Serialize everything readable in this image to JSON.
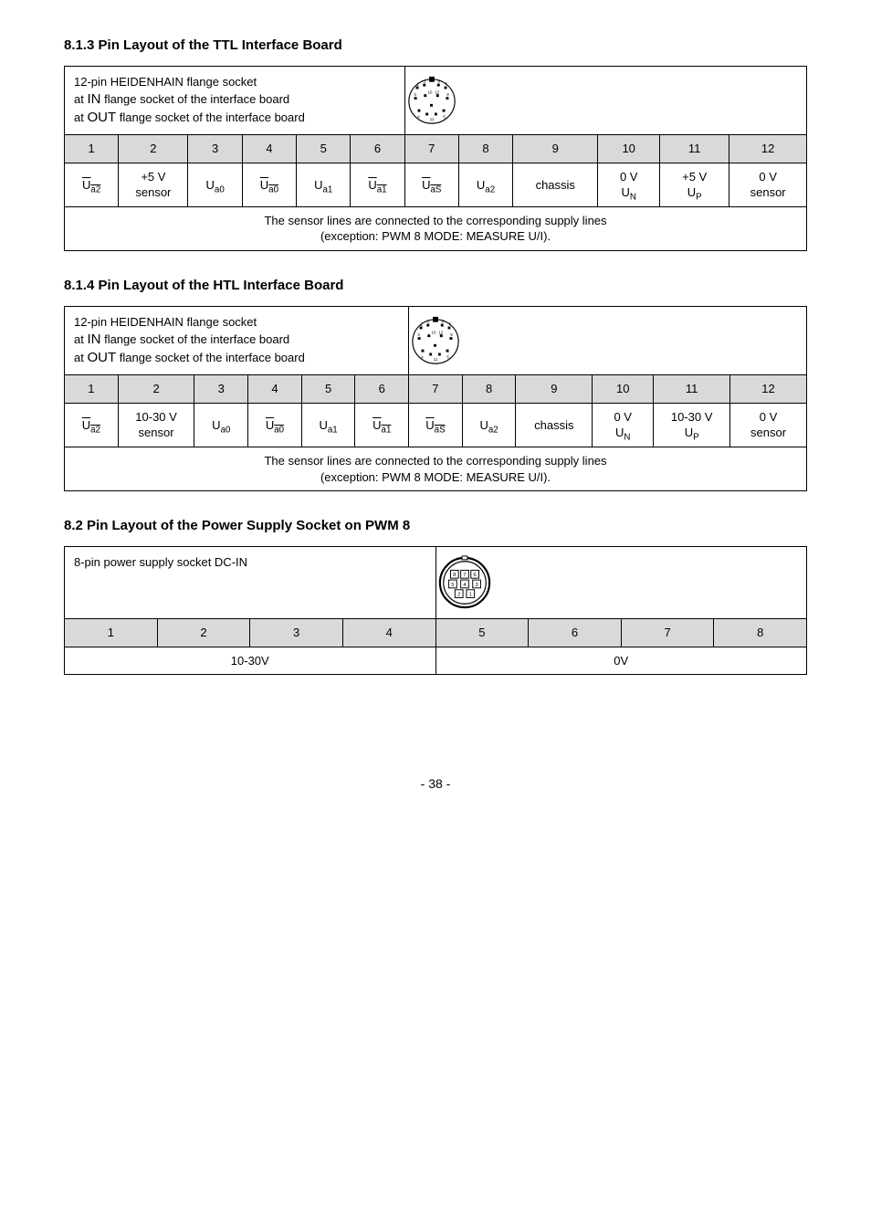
{
  "sections": {
    "ttl": {
      "title": "8.1.3 Pin Layout of the TTL Interface Board",
      "socket_lines": {
        "l1": "12-pin HEIDENHAIN flange socket",
        "l2_pre": "at ",
        "l2_caps": "IN",
        "l2_post": " flange socket of the interface board",
        "l3_pre": "at ",
        "l3_caps": "OUT",
        "l3_post": " flange socket of the interface board"
      },
      "headers": [
        "1",
        "2",
        "3",
        "4",
        "5",
        "6",
        "7",
        "8",
        "9",
        "10",
        "11",
        "12"
      ],
      "row_plain": {
        "c1_sym": "Ua2_ov",
        "c2": "+5 V\nsensor",
        "c3_sym": "Ua0",
        "c4_sym": "Ua0_ov",
        "c5_sym": "Ua1",
        "c6_sym": "Ua1_ov",
        "c7_sym": "UaS_ov",
        "c8_sym": "Ua2",
        "c9": "chassis",
        "c10_a": "0 V",
        "c10_b_sym": "UN",
        "c11_a": "+5 V",
        "c11_b_sym": "UP",
        "c12": "0 V\nsensor"
      },
      "note": "The sensor lines are connected to the corresponding supply lines\n(exception: PWM 8 MODE: MEASURE U/I)."
    },
    "htl": {
      "title": "8.1.4 Pin Layout of the HTL Interface Board",
      "socket_lines": {
        "l1": "12-pin HEIDENHAIN flange socket",
        "l2_pre": "at ",
        "l2_caps": "IN",
        "l2_post": " flange socket of the interface board",
        "l3_pre": "at ",
        "l3_caps": "OUT",
        "l3_post": " flange socket of the interface board"
      },
      "headers": [
        "1",
        "2",
        "3",
        "4",
        "5",
        "6",
        "7",
        "8",
        "9",
        "10",
        "11",
        "12"
      ],
      "row_plain": {
        "c1_sym": "Ua2_ov",
        "c2": "10-30 V\nsensor",
        "c3_sym": "Ua0",
        "c4_sym": "Ua0_ov",
        "c5_sym": "Ua1",
        "c6_sym": "Ua1_ov",
        "c7_sym": "UaS_ov",
        "c8_sym": "Ua2",
        "c9": "chassis",
        "c10_a": "0 V",
        "c10_b_sym": "UN",
        "c11_a": "10-30 V",
        "c11_b_sym": "UP",
        "c12": "0 V\nsensor"
      },
      "note": "The sensor lines are connected to the corresponding supply lines\n(exception: PWM 8 MODE: MEASURE U/I)."
    },
    "power": {
      "title": "8.2 Pin Layout of the Power Supply Socket on PWM 8",
      "socket_label": "8-pin power supply socket DC-IN",
      "headers": [
        "1",
        "2",
        "3",
        "4",
        "5",
        "6",
        "7",
        "8"
      ],
      "vals": {
        "left": "10-30V",
        "right": "0V"
      }
    }
  },
  "page_number": "- 38 -"
}
